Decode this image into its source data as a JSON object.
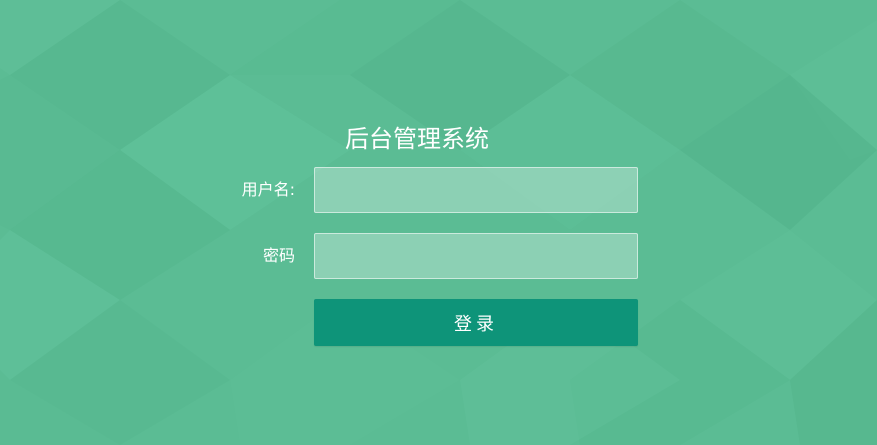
{
  "page": {
    "title": "后台管理系统",
    "accent_color": "#0e9479",
    "background_color": "#5bbc94"
  },
  "form": {
    "username_label": "用户名:",
    "username_value": "",
    "password_label": "密码",
    "password_value": "",
    "submit_label": "登录"
  }
}
